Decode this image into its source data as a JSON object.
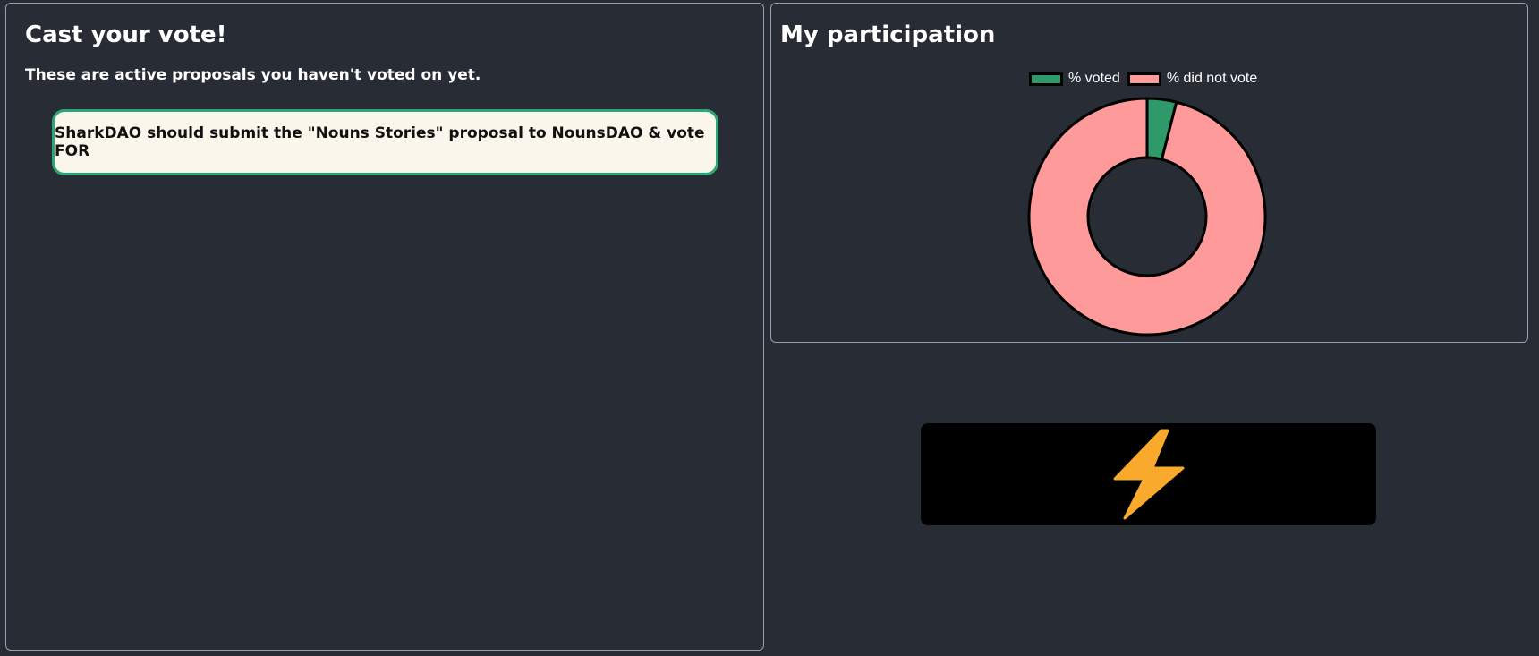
{
  "left_panel": {
    "title": "Cast your vote!",
    "subtitle": "These are active proposals you haven't voted on yet.",
    "proposals": [
      {
        "title": "SharkDAO should submit the \"Nouns Stories\" proposal to NounsDAO & vote FOR"
      }
    ]
  },
  "right_panel": {
    "title": "My participation"
  },
  "badge": {
    "icon": "lightning-bolt-icon",
    "color": "#f9a92c"
  },
  "chart_data": {
    "type": "pie",
    "variant": "doughnut",
    "labels": [
      "% voted",
      "% did not vote"
    ],
    "values": [
      4,
      96
    ],
    "colors": [
      "#2e9a6a",
      "#ff9a9b"
    ],
    "legend": "top-center"
  }
}
